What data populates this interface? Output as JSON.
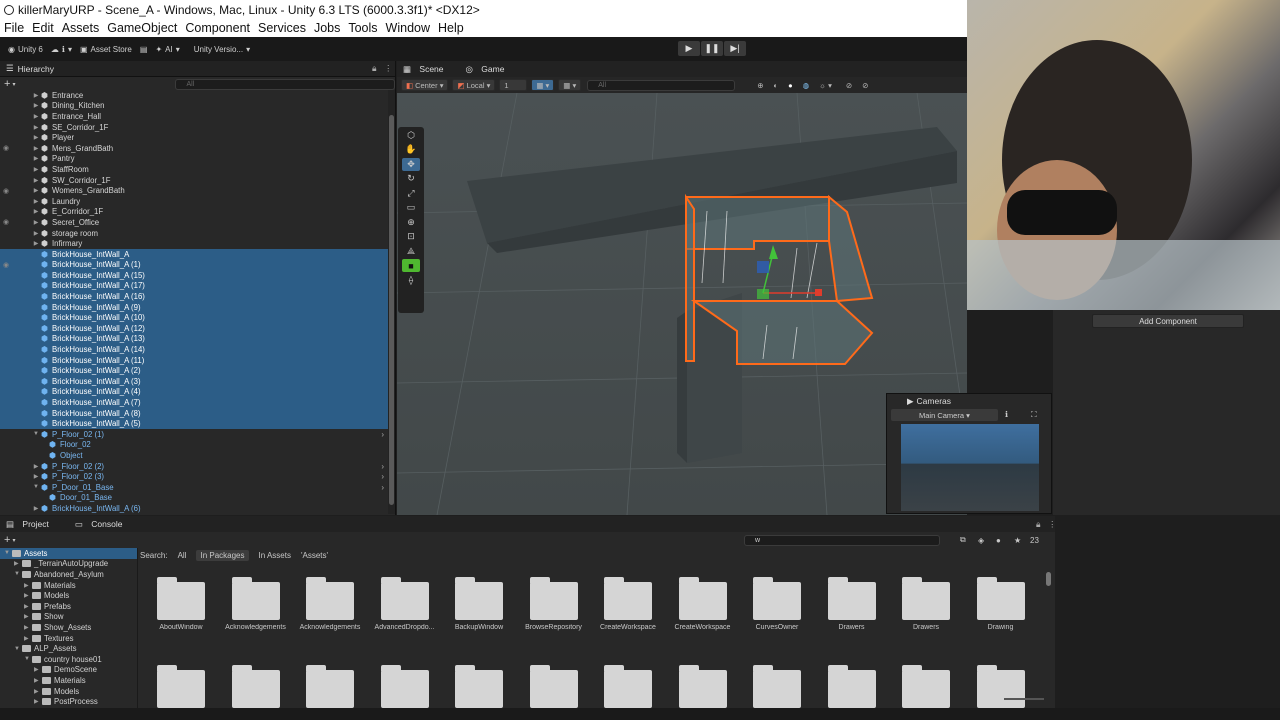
{
  "window": {
    "title": "killerMaryURP - Scene_A - Windows, Mac, Linux - Unity 6.3 LTS (6000.3.3f1)* <DX12>"
  },
  "menu": [
    "File",
    "Edit",
    "Assets",
    "GameObject",
    "Component",
    "Services",
    "Jobs",
    "Tools",
    "Window",
    "Help"
  ],
  "toolbar": {
    "unity": "Unity 6",
    "account": "ℹ",
    "asset_store": "Asset Store",
    "ai": "AI",
    "version": "Unity Versio..."
  },
  "hierarchy": {
    "tab": "Hierarchy",
    "search_placeholder": "All",
    "rows": [
      {
        "label": "Entrance",
        "sel": false,
        "blue": false
      },
      {
        "label": "Dining_Kitchen",
        "sel": false,
        "blue": false
      },
      {
        "label": "Entrance_Hall",
        "sel": false,
        "blue": false
      },
      {
        "label": "SE_Corridor_1F",
        "sel": false,
        "blue": false
      },
      {
        "label": "Player",
        "sel": false,
        "blue": false
      },
      {
        "label": "Mens_GrandBath",
        "sel": false,
        "blue": false
      },
      {
        "label": "Pantry",
        "sel": false,
        "blue": false
      },
      {
        "label": "StaffRoom",
        "sel": false,
        "blue": false
      },
      {
        "label": "SW_Corridor_1F",
        "sel": false,
        "blue": false
      },
      {
        "label": "Womens_GrandBath",
        "sel": false,
        "blue": false
      },
      {
        "label": "Laundry",
        "sel": false,
        "blue": false
      },
      {
        "label": "E_Corridor_1F",
        "sel": false,
        "blue": false
      },
      {
        "label": "Secret_Office",
        "sel": false,
        "blue": false
      },
      {
        "label": "storage room",
        "sel": false,
        "blue": false
      },
      {
        "label": "Infirmary",
        "sel": false,
        "blue": false
      },
      {
        "label": "BrickHouse_IntWall_A",
        "sel": true,
        "blue": true
      },
      {
        "label": "BrickHouse_IntWall_A (1)",
        "sel": true,
        "blue": true
      },
      {
        "label": "BrickHouse_IntWall_A (15)",
        "sel": true,
        "blue": true
      },
      {
        "label": "BrickHouse_IntWall_A (17)",
        "sel": true,
        "blue": true
      },
      {
        "label": "BrickHouse_IntWall_A (16)",
        "sel": true,
        "blue": true
      },
      {
        "label": "BrickHouse_IntWall_A (9)",
        "sel": true,
        "blue": true
      },
      {
        "label": "BrickHouse_IntWall_A (10)",
        "sel": true,
        "blue": true
      },
      {
        "label": "BrickHouse_IntWall_A (12)",
        "sel": true,
        "blue": true
      },
      {
        "label": "BrickHouse_IntWall_A (13)",
        "sel": true,
        "blue": true
      },
      {
        "label": "BrickHouse_IntWall_A (14)",
        "sel": true,
        "blue": true
      },
      {
        "label": "BrickHouse_IntWall_A (11)",
        "sel": true,
        "blue": true
      },
      {
        "label": "BrickHouse_IntWall_A (2)",
        "sel": true,
        "blue": true
      },
      {
        "label": "BrickHouse_IntWall_A (3)",
        "sel": true,
        "blue": true
      },
      {
        "label": "BrickHouse_IntWall_A (4)",
        "sel": true,
        "blue": true
      },
      {
        "label": "BrickHouse_IntWall_A (7)",
        "sel": true,
        "blue": true
      },
      {
        "label": "BrickHouse_IntWall_A (8)",
        "sel": true,
        "blue": true
      },
      {
        "label": "BrickHouse_IntWall_A (5)",
        "sel": true,
        "blue": true
      },
      {
        "label": "P_Floor_02 (1)",
        "sel": false,
        "blue": true
      },
      {
        "label": "Floor_02",
        "sel": false,
        "blue": true
      },
      {
        "label": "Object",
        "sel": false,
        "blue": true
      },
      {
        "label": "P_Floor_02 (2)",
        "sel": false,
        "blue": true
      },
      {
        "label": "P_Floor_02 (3)",
        "sel": false,
        "blue": true
      },
      {
        "label": "P_Door_01_Base",
        "sel": false,
        "blue": true
      },
      {
        "label": "Door_01_Base",
        "sel": false,
        "blue": true
      },
      {
        "label": "BrickHouse_IntWall_A (6)",
        "sel": false,
        "blue": true
      }
    ]
  },
  "scene": {
    "tabs": [
      "Scene",
      "Game"
    ],
    "pivot": "Center",
    "space": "Local",
    "snap": "1",
    "search_placeholder": "All"
  },
  "cameras": {
    "title": "Cameras",
    "selected": "Main Camera"
  },
  "inspector": {
    "add_component": "Add Component"
  },
  "project": {
    "tabs": [
      "Project",
      "Console"
    ],
    "search_value": "w",
    "count": "23",
    "search_label": "Search:",
    "filters": [
      "All",
      "In Packages",
      "In Assets",
      "'Assets'"
    ],
    "tree": [
      {
        "label": "Assets",
        "indent": 0,
        "sel": true
      },
      {
        "label": "_TerrainAutoUpgrade",
        "indent": 1,
        "sel": false
      },
      {
        "label": "Abandoned_Asylum",
        "indent": 1,
        "sel": false
      },
      {
        "label": "Materials",
        "indent": 2,
        "sel": false
      },
      {
        "label": "Models",
        "indent": 2,
        "sel": false
      },
      {
        "label": "Prefabs",
        "indent": 2,
        "sel": false
      },
      {
        "label": "Show",
        "indent": 2,
        "sel": false
      },
      {
        "label": "Show_Assets",
        "indent": 2,
        "sel": false
      },
      {
        "label": "Textures",
        "indent": 2,
        "sel": false
      },
      {
        "label": "ALP_Assets",
        "indent": 1,
        "sel": false
      },
      {
        "label": "country house01",
        "indent": 2,
        "sel": false
      },
      {
        "label": "DemoScene",
        "indent": 3,
        "sel": false
      },
      {
        "label": "Materials",
        "indent": 3,
        "sel": false
      },
      {
        "label": "Models",
        "indent": 3,
        "sel": false
      },
      {
        "label": "PostProcess",
        "indent": 3,
        "sel": false
      }
    ],
    "items": [
      "AboutWindow",
      "Acknowledgements",
      "Acknowledgements",
      "AdvancedDropdo...",
      "BackupWindow",
      "BrowseRepository",
      "CreateWorkspace",
      "CreateWorkspace",
      "CurvesOwner",
      "Drawers",
      "Drawers",
      "Drawing"
    ]
  }
}
